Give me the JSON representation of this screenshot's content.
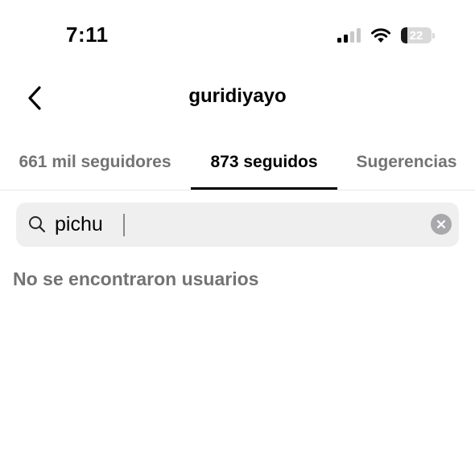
{
  "status_bar": {
    "time": "7:11",
    "battery_level": "22",
    "signal_icon": "cellular-signal-icon",
    "wifi_icon": "wifi-icon",
    "battery_icon": "battery-icon"
  },
  "header": {
    "title": "guridiyayo",
    "back_icon": "chevron-left-icon"
  },
  "tabs": [
    {
      "label": "661 mil seguidores",
      "active": false
    },
    {
      "label": "873 seguidos",
      "active": true
    },
    {
      "label": "Sugerencias",
      "active": false
    }
  ],
  "search": {
    "value": "pichu",
    "icon": "search-icon",
    "clear_icon": "clear-icon"
  },
  "results": {
    "empty_message": "No se encontraron usuarios"
  },
  "colors": {
    "primary_text": "#000000",
    "secondary_text": "#737373",
    "search_background": "#efefef",
    "tab_indicator": "#000000"
  }
}
